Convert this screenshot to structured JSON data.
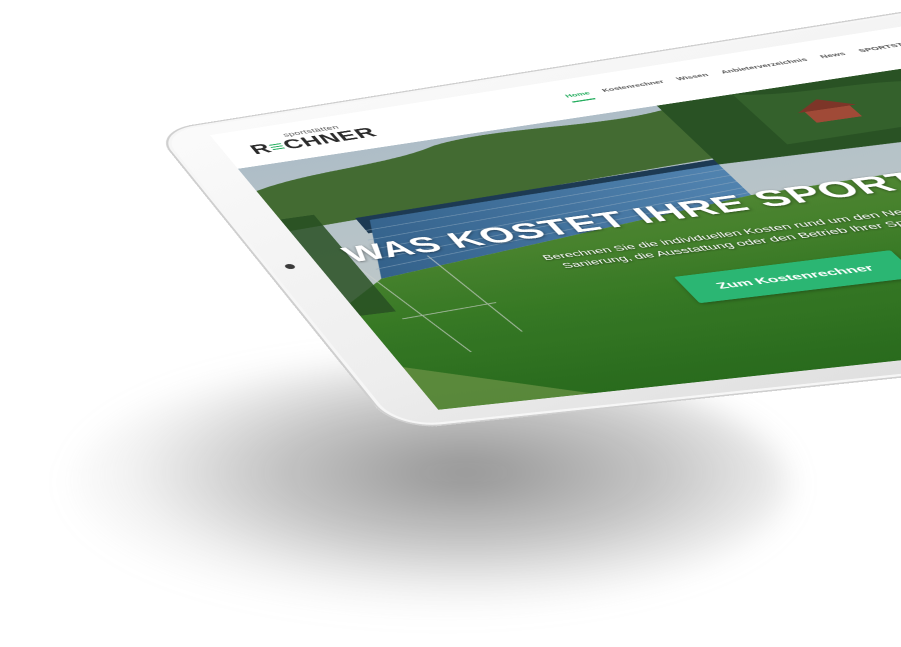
{
  "brand": {
    "logo_small": "sportstätten",
    "logo_prefix": "R",
    "logo_accent": "≡",
    "logo_suffix": "CHNER",
    "accent_color": "#27ae60"
  },
  "nav": {
    "items": [
      {
        "label": "Home",
        "active": true
      },
      {
        "label": "Kostenrechner",
        "active": false
      },
      {
        "label": "Wissen",
        "active": false
      },
      {
        "label": "Anbieterverzeichnis",
        "active": false
      },
      {
        "label": "News",
        "active": false
      },
      {
        "label": "SPORTSTÄTTENREFERATOR",
        "active": false
      }
    ],
    "search_icon": "search-icon"
  },
  "hero": {
    "title": "WAS KOSTET IHRE SPORTSTÄTTE?",
    "text": "Berechnen Sie die individuellen Kosten rund um den Neubau, die Sanierung, die Ausstattung oder den Betrieb Ihrer Sportstätte.",
    "cta_label": "Zum Kostenrechner",
    "cta_color": "#2bb673"
  },
  "device": {
    "icons": [
      "camera-icon",
      "home-button-icon"
    ]
  }
}
